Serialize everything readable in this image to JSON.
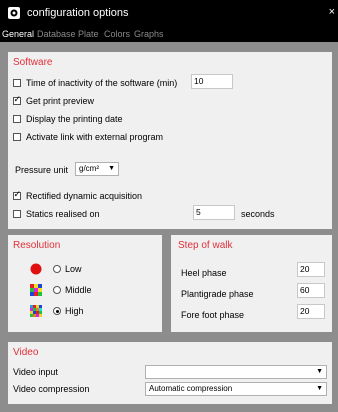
{
  "window": {
    "title": "configuration options",
    "close_glyph": "×"
  },
  "tabs": [
    {
      "label": "General",
      "active": true
    },
    {
      "label": "Database",
      "active": false
    },
    {
      "label": "Plate",
      "active": false
    },
    {
      "label": "Colors",
      "active": false
    },
    {
      "label": "Graphs",
      "active": false
    }
  ],
  "software": {
    "title": "Software",
    "inactivity": {
      "label": "Time of inactivity of the software (min)",
      "checked": false,
      "value": "10"
    },
    "print_preview": {
      "label": "Get print preview",
      "checked": true
    },
    "display_date": {
      "label": "Display the printing date",
      "checked": false
    },
    "activate_link": {
      "label": "Activate link with external program",
      "checked": false
    },
    "pressure_unit": {
      "label": "Pressure unit",
      "value": "g/cm²"
    },
    "rectified": {
      "label": "Rectified dynamic acquisition",
      "checked": true
    },
    "statics": {
      "label": "Statics realised on",
      "checked": false,
      "value": "5",
      "unit": "seconds"
    }
  },
  "resolution": {
    "title": "Resolution",
    "options": [
      {
        "label": "Low",
        "selected": false,
        "icon": "red-dot-icon"
      },
      {
        "label": "Middle",
        "selected": false,
        "icon": "color-grid-icon"
      },
      {
        "label": "High",
        "selected": true,
        "icon": "fine-color-grid-icon"
      }
    ]
  },
  "step": {
    "title": "Step of walk",
    "heel": {
      "label": "Heel phase",
      "value": "20"
    },
    "plantigrade": {
      "label": "Plantigrade phase",
      "value": "60"
    },
    "fore_foot": {
      "label": "Fore foot phase",
      "value": "20"
    }
  },
  "video": {
    "title": "Video",
    "input": {
      "label": "Video input",
      "value": ""
    },
    "compression": {
      "label": "Video compression",
      "value": "Automatic compression"
    }
  },
  "colors": {
    "accent": "#e0303a",
    "panel": "#f0f0f0",
    "background": "#8d8d8d",
    "titlebar": "#000000"
  }
}
